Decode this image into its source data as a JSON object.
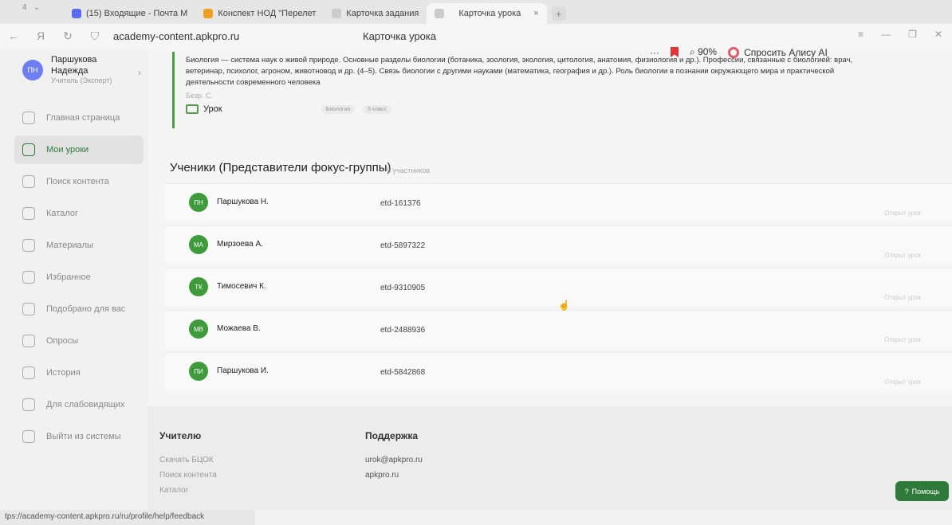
{
  "browser": {
    "tabs": [
      {
        "label": "(15) Входящие - Почта М",
        "color": "#5b6bf0"
      },
      {
        "label": "Конспект НОД \"Перелет",
        "color": "#f0a020"
      },
      {
        "label": "Карточка задания",
        "color": "#bbbbbb"
      },
      {
        "label": "Карточка урока",
        "color": "#bbbbbb",
        "active": true
      }
    ],
    "new_tab": "+",
    "tab_close": "×",
    "url": "academy-content.apkpro.ru",
    "page_title": "Карточка урока",
    "zoom": "90%",
    "alice_label": "Спросить Алису AI",
    "more": "···"
  },
  "sidebar": {
    "user_initials": "ПН",
    "user_name_line1": "Паршукова",
    "user_name_line2": "Надежда",
    "user_role": "Учитель (Эксперт)",
    "items": [
      {
        "label": "Главная страница",
        "icon": "home-icon"
      },
      {
        "label": "Мои уроки",
        "icon": "graduation-cap-icon",
        "active": true
      },
      {
        "label": "Поиск контента",
        "icon": "search-icon"
      },
      {
        "label": "Каталог",
        "icon": "book-icon"
      },
      {
        "label": "Материалы",
        "icon": "grid-icon"
      },
      {
        "label": "Избранное",
        "icon": "star-icon"
      },
      {
        "label": "Подобрано для вас",
        "icon": "user-icon"
      },
      {
        "label": "Опросы",
        "icon": "clipboard-icon"
      },
      {
        "label": "История",
        "icon": "clock-icon"
      },
      {
        "label": "Для слабовидящих",
        "icon": "glasses-icon"
      },
      {
        "label": "Выйти из системы",
        "icon": "logout-icon"
      }
    ]
  },
  "lesson": {
    "description": "Биология — система наук о живой природе. Основные разделы биологии (ботаника, зоология, экология, цитология, анатомия, физиология и др.). Профессии, связанные с биологией: врач, ветеринар, психолог, агроном, животновод и др. (4–5). Связь биологии с другими науками (математика, география и др.). Роль биологии в познании окружающего мира и практической деятельности современного человека",
    "author": "Безр. С.",
    "type": "Урок",
    "tags": [
      "Биология",
      "5 класс"
    ]
  },
  "students": {
    "title": "Ученики (Представители фокус-группы)",
    "count": "5 участников",
    "open_label": "Открыт урок",
    "list": [
      {
        "initials": "ПН",
        "name": "Паршукова Н.",
        "id": "etd-161376"
      },
      {
        "initials": "МА",
        "name": "Мирзоева А.",
        "id": "etd-5897322"
      },
      {
        "initials": "ТК",
        "name": "Тимосевич К.",
        "id": "etd-9310905"
      },
      {
        "initials": "МВ",
        "name": "Можаева В.",
        "id": "etd-2488936"
      },
      {
        "initials": "ПИ",
        "name": "Паршукова И.",
        "id": "etd-5842868"
      }
    ]
  },
  "footer": {
    "teacher_title": "Учителю",
    "teacher_links": [
      "Скачать БЦОК",
      "Поиск контента",
      "Каталог"
    ],
    "support_title": "Поддержка",
    "support_links": [
      "urok@apkpro.ru",
      "apkpro.ru"
    ]
  },
  "help_button": "Помощь",
  "status_url": "tps://academy-content.apkpro.ru/ru/profile/help/feedback"
}
